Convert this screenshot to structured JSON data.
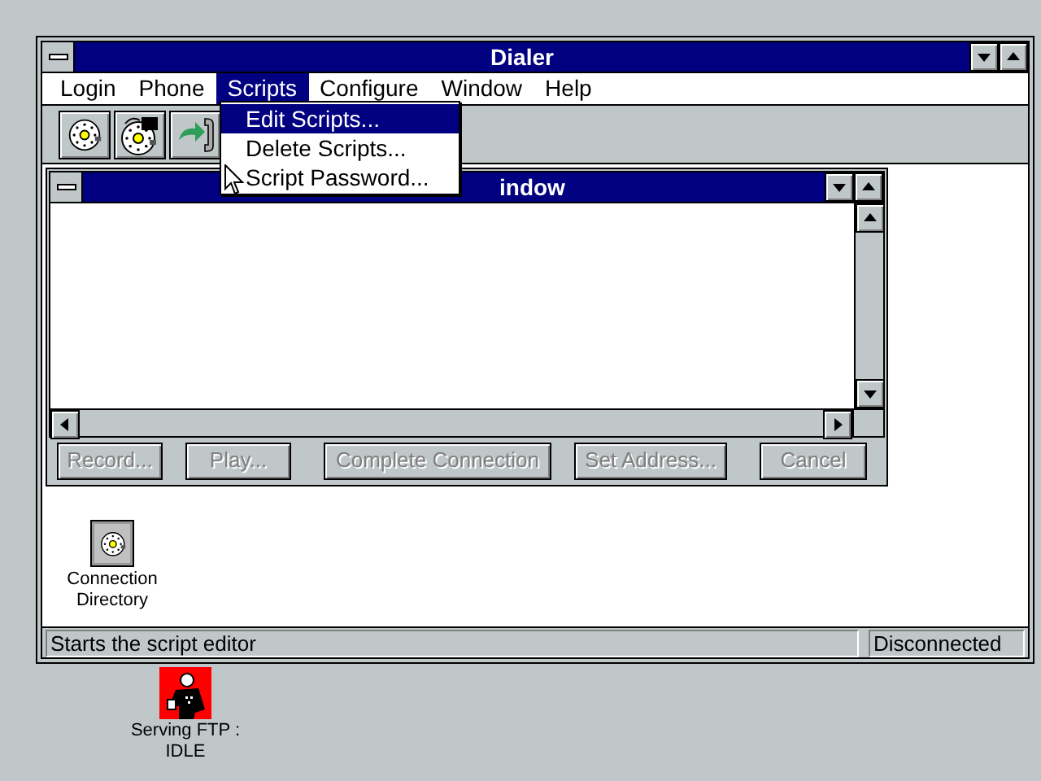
{
  "window": {
    "title": "Dialer"
  },
  "menu_bar": [
    {
      "label": "Login",
      "selected": false
    },
    {
      "label": "Phone",
      "selected": false
    },
    {
      "label": "Scripts",
      "selected": true
    },
    {
      "label": "Configure",
      "selected": false
    },
    {
      "label": "Window",
      "selected": false
    },
    {
      "label": "Help",
      "selected": false
    }
  ],
  "toolbar": [
    {
      "kind": "dial"
    },
    {
      "kind": "redial"
    },
    {
      "kind": "hangup"
    }
  ],
  "menu": {
    "items": [
      {
        "label": "Edit Scripts...",
        "selected": true
      },
      {
        "label": "Delete Scripts...",
        "selected": false
      },
      {
        "label": "Script Password...",
        "selected": false
      }
    ]
  },
  "child_window": {
    "title": "indow",
    "buttons": [
      {
        "label": "Record...",
        "disabled": true
      },
      {
        "label": "Play...",
        "disabled": true
      },
      {
        "label": "Complete Connection",
        "disabled": true
      },
      {
        "label": "Set Address...",
        "disabled": true
      },
      {
        "label": "Cancel",
        "disabled": true
      }
    ]
  },
  "icons": [
    {
      "label": "Connection\nDirectory"
    }
  ],
  "status_bar": {
    "message": "Starts the script editor",
    "state": "Disconnected"
  },
  "desktop_icons": [
    {
      "label": "Serving FTP :\nIDLE"
    }
  ]
}
